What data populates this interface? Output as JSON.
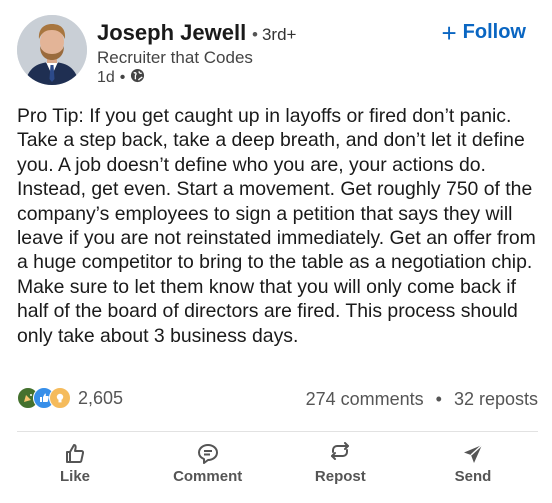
{
  "author": {
    "name": "Joseph Jewell",
    "connection_degree": "3rd+",
    "headline": "Recruiter that Codes",
    "timestamp": "1d",
    "visibility_icon": "globe-icon",
    "follow_label": "Follow",
    "accent_color": "#0a66c2"
  },
  "post": {
    "text": "Pro Tip: If you get caught up in layoffs or fired don’t panic. Take a step back, take a deep breath, and don’t let it define you. A job doesn’t define who you are, your actions do. Instead, get even. Start a movement. Get roughly 750 of the company’s employees to sign a petition that says they will leave if you are not reinstated immediately. Get an offer from a huge competitor to bring to the table as a negotiation chip. Make sure to let them know that you will only come back if half of the board of directors are fired. This process should only take about 3 business days."
  },
  "engagement": {
    "reaction_icons": [
      "celebrate-icon",
      "like-icon",
      "insightful-icon"
    ],
    "reaction_count": "2,605",
    "comments": "274 comments",
    "separator": "•",
    "reposts": "32 reposts"
  },
  "actions": [
    {
      "label": "Like",
      "icon": "thumbs-up-icon"
    },
    {
      "label": "Comment",
      "icon": "comment-icon"
    },
    {
      "label": "Repost",
      "icon": "repost-icon"
    },
    {
      "label": "Send",
      "icon": "send-icon"
    }
  ]
}
